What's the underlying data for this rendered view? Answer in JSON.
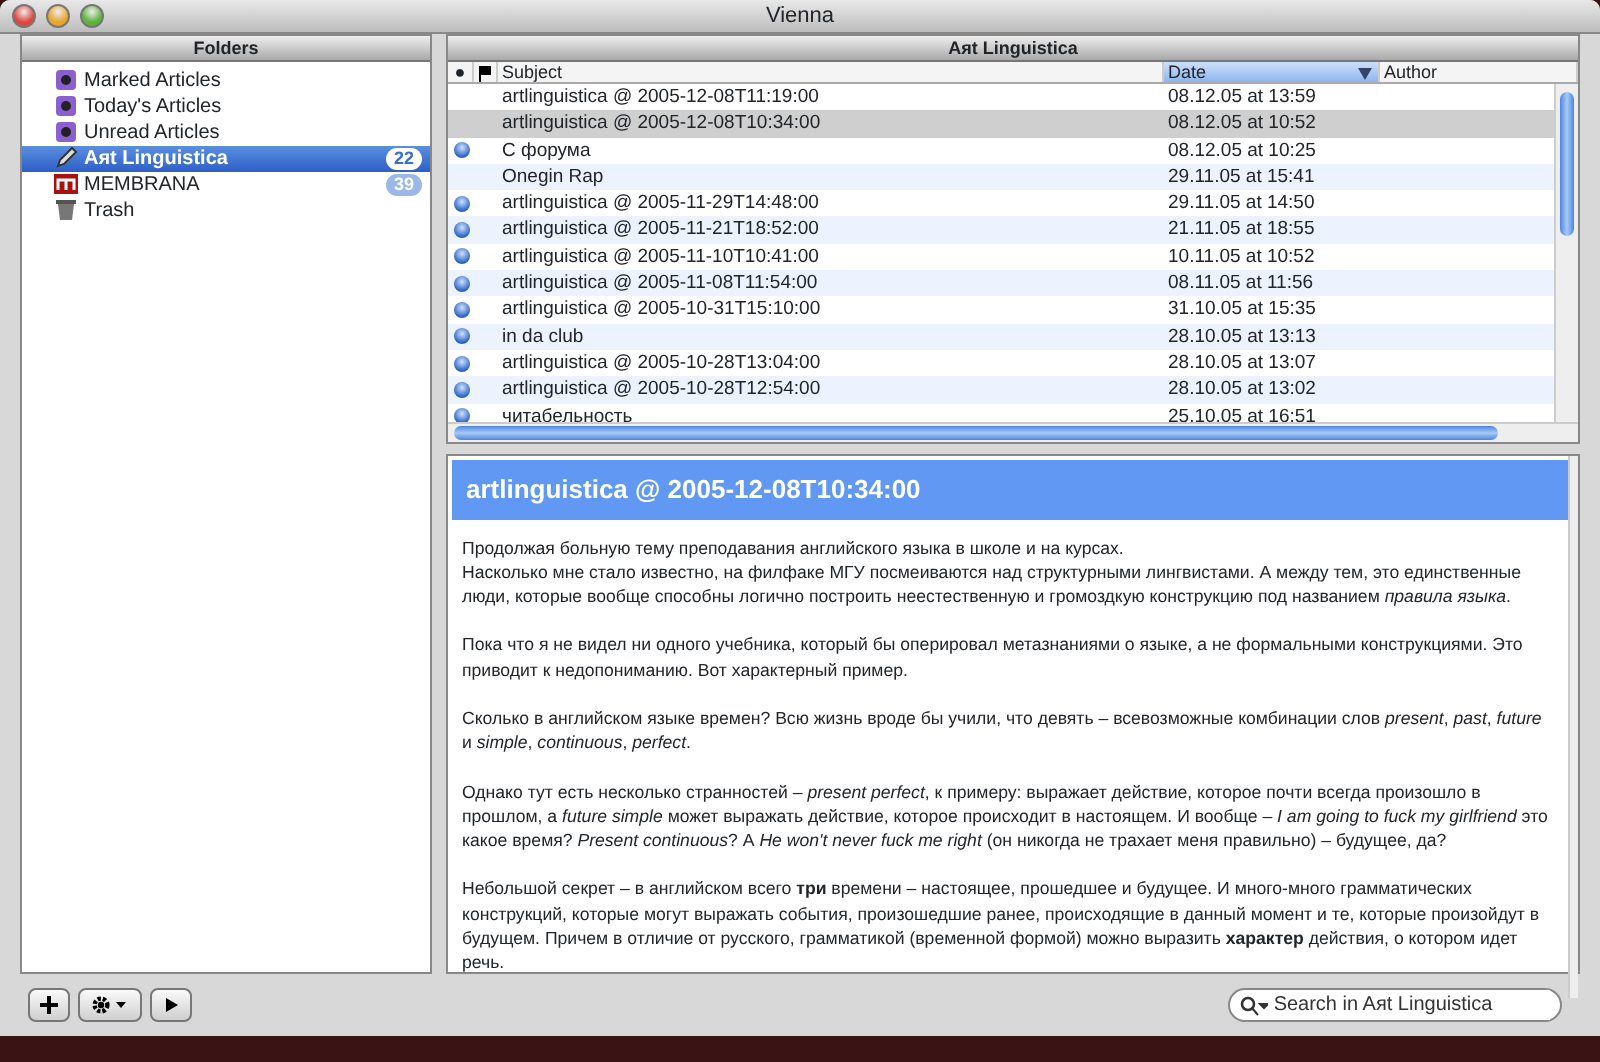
{
  "window": {
    "title": "Vienna"
  },
  "folders": {
    "header": "Folders",
    "items": [
      {
        "kind": "smart",
        "label": "Marked Articles",
        "selected": false
      },
      {
        "kind": "smart",
        "label": "Today's Articles",
        "selected": false
      },
      {
        "kind": "smart",
        "label": "Unread Articles",
        "selected": false
      },
      {
        "kind": "feed",
        "label": "Aяt Linguistica",
        "count": "22",
        "selected": true
      },
      {
        "kind": "m",
        "label": "MEMBRANA",
        "count": "39",
        "selected": false
      },
      {
        "kind": "trash",
        "label": "Trash",
        "selected": false
      }
    ]
  },
  "articles": {
    "title": "Aяt Linguistica",
    "columns": [
      {
        "kind": "unread",
        "label": "●",
        "sorted": false
      },
      {
        "kind": "flag",
        "sorted": false
      },
      {
        "kind": "text",
        "label": "Subject",
        "sorted": false
      },
      {
        "kind": "text",
        "label": "Date",
        "sorted": true
      },
      {
        "kind": "text",
        "label": "Author",
        "sorted": false
      }
    ],
    "rows": [
      {
        "unread": false,
        "subject": "artlinguistica @ 2005-12-08T11:19:00",
        "date": "08.12.05 at 13:59",
        "selected": false
      },
      {
        "unread": false,
        "subject": "artlinguistica @ 2005-12-08T10:34:00",
        "date": "08.12.05 at 10:52",
        "selected": true
      },
      {
        "unread": true,
        "subject": "С форума",
        "date": "08.12.05 at 10:25",
        "selected": false
      },
      {
        "unread": false,
        "subject": "Onegin Rap",
        "date": "29.11.05 at 15:41",
        "selected": false
      },
      {
        "unread": true,
        "subject": "artlinguistica @ 2005-11-29T14:48:00",
        "date": "29.11.05 at 14:50",
        "selected": false
      },
      {
        "unread": true,
        "subject": "artlinguistica @ 2005-11-21T18:52:00",
        "date": "21.11.05 at 18:55",
        "selected": false
      },
      {
        "unread": true,
        "subject": "artlinguistica @ 2005-11-10T10:41:00",
        "date": "10.11.05 at 10:52",
        "selected": false
      },
      {
        "unread": true,
        "subject": "artlinguistica @ 2005-11-08T11:54:00",
        "date": "08.11.05 at 11:56",
        "selected": false
      },
      {
        "unread": true,
        "subject": "artlinguistica @ 2005-10-31T15:10:00",
        "date": "31.10.05 at 15:35",
        "selected": false
      },
      {
        "unread": true,
        "subject": "in da club",
        "date": "28.10.05 at 13:13",
        "selected": false
      },
      {
        "unread": true,
        "subject": "artlinguistica @ 2005-10-28T13:04:00",
        "date": "28.10.05 at 13:07",
        "selected": false
      },
      {
        "unread": true,
        "subject": "artlinguistica @ 2005-10-28T12:54:00",
        "date": "28.10.05 at 13:02",
        "selected": false
      },
      {
        "unread": true,
        "subject": "читабельность",
        "date": "25.10.05 at 16:51",
        "selected": false
      }
    ]
  },
  "preview": {
    "title": "artlinguistica @ 2005-12-08T10:34:00",
    "paragraphs": [
      [
        "Продолжая больную тему преподавания английского языка в школе и на курсах.",
        "Насколько мне стало известно, на филфаке МГУ посмеиваются над структурными лингвистами. А между тем, это единственные люди, которые вообще способны логично построить неестественную и громоздкую конструкцию под названием *правила языка*."
      ],
      [
        "Пока что я не видел ни одного учебника, который бы оперировал метазнаниями о языке, а не формальными конструкциями. Это приводит к недопониманию. Вот характерный пример."
      ],
      [
        "Сколько в английском языке времен? Всю жизнь вроде бы учили, что девять – всевозможные комбинации слов *present*, *past*, *future* и *simple*, *continuous*, *perfect*."
      ],
      [
        "Однако тут есть несколько странностей – *present perfect*, к примеру: выражает действие, которое почти всегда произошло в прошлом, а *future simple* может выражать действие, которое происходит в настоящем. И вообще – *I am going to fuck my girlfriend* это какое время? *Present continuous*? А *He won't never fuck me right* (он никогда не трахает меня правильно) – будущее, да?"
      ],
      [
        "Небольшой секрет – в английском всего **три** времени – настоящее, прошедшее и будущее. И много-много грамматических конструкций, которые могут выражать события, произошедшие ранее, происходящие в данный момент и те, которые произойдут в будущем. Причем в отличие от русского, грамматикой (временной формой) можно выразить **характер** действия, о котором идет речь."
      ]
    ]
  },
  "search": {
    "placeholder": "Search in Aяt Linguistica"
  }
}
